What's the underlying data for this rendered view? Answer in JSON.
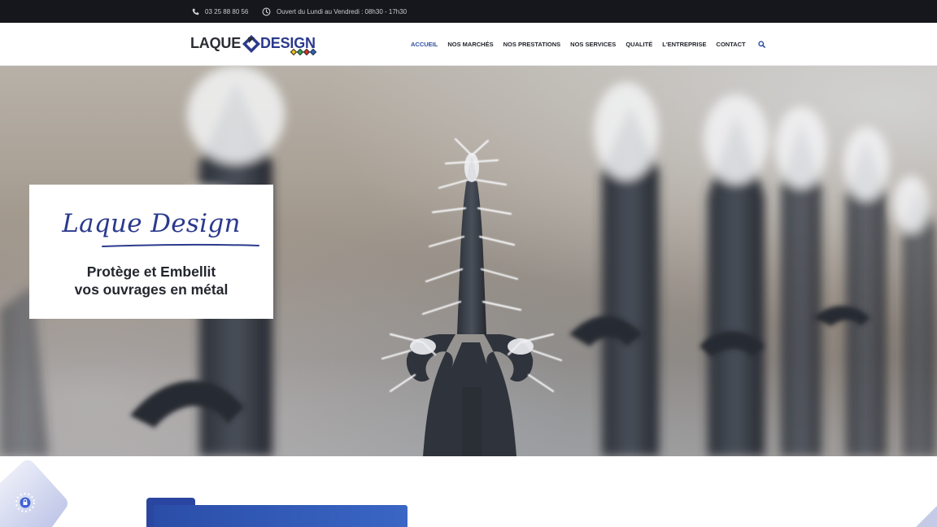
{
  "topbar": {
    "phone": "03 25 88 80 56",
    "hours": "Ouvert du Lundi au Vendredi : 08h30 - 17h30"
  },
  "logo": {
    "word1": "LAQUE",
    "word2": "DESIGN"
  },
  "nav": {
    "items": [
      {
        "label": "ACCUEIL",
        "active": true
      },
      {
        "label": "NOS MARCHÉS"
      },
      {
        "label": "NOS PRESTATIONS"
      },
      {
        "label": "NOS SERVICES"
      },
      {
        "label": "QUALITÉ"
      },
      {
        "label": "L'ENTREPRISE"
      },
      {
        "label": "CONTACT"
      }
    ],
    "search_icon": "search-icon"
  },
  "hero": {
    "title": "Laque Design",
    "tagline_line1": "Protège et Embellit",
    "tagline_line2": "vos ouvrages en métal"
  },
  "colors": {
    "brand_blue": "#2b3a8c",
    "accent_blue": "#2d4fa0",
    "topbar_bg": "#16171c"
  },
  "icons": {
    "phone": "phone-icon",
    "clock": "clock-icon",
    "cookie_widget": "shield-cookie-icon"
  }
}
